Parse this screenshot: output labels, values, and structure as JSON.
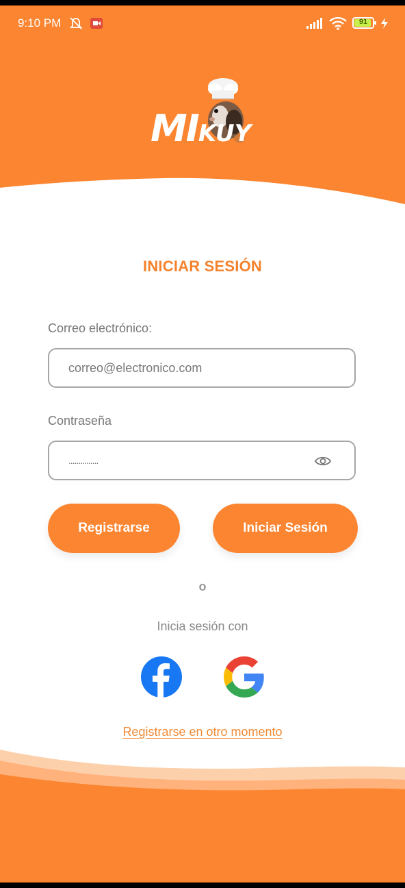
{
  "status_bar": {
    "time": "9:10 PM",
    "battery": "91"
  },
  "brand": {
    "logo_text_left": "MI",
    "logo_text_right": "KUY"
  },
  "login": {
    "title": "INICIAR SESIÓN",
    "email_label": "Correo electrónico:",
    "email_placeholder": "correo@electronico.com",
    "password_label": "Contraseña",
    "password_placeholder": "...............",
    "register_button": "Registrarse",
    "login_button": "Iniciar Sesión",
    "or_text": "o",
    "social_text": "Inicia sesión con",
    "later_link": "Registrarse en otro momento"
  },
  "colors": {
    "brand_orange": "#fb8530",
    "title_orange": "#f5822c"
  },
  "icons": [
    "mute-icon",
    "camera-icon",
    "signal-icon",
    "wifi-icon",
    "battery-icon",
    "charging-icon",
    "eye-icon",
    "facebook-icon",
    "google-icon"
  ]
}
